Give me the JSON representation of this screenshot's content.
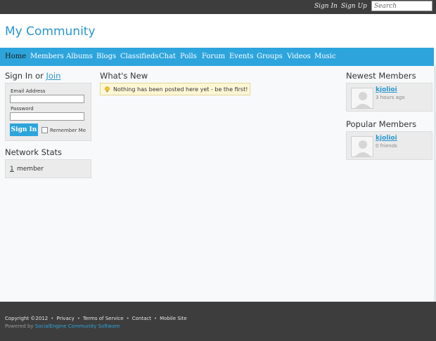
{
  "topbar": {
    "sign_in": "Sign In",
    "sign_up": "Sign Up",
    "search_placeholder": "Search"
  },
  "header": {
    "site_title": "My Community"
  },
  "nav": {
    "items": [
      "Home",
      "Members",
      "Albums",
      "Blogs",
      "Classifieds",
      "Chat",
      "Polls",
      "Forum",
      "Events",
      "Groups",
      "Videos",
      "Music"
    ],
    "active": "Home"
  },
  "signin": {
    "title_prefix": "Sign In or ",
    "title_join": "Join",
    "email_label": "Email Address",
    "password_label": "Password",
    "button_label": "Sign In",
    "remember_label": "Remember Me"
  },
  "stats": {
    "title": "Network Stats",
    "count": "1",
    "label": "member"
  },
  "whats_new": {
    "title": "What's New",
    "notice": "Nothing has been posted here yet - be the first!"
  },
  "newest": {
    "title": "Newest Members",
    "name": "kjolioi",
    "meta": "3 hours ago"
  },
  "popular": {
    "title": "Popular Members",
    "name": "kjolioi",
    "meta": "0 friends"
  },
  "footer": {
    "copyright": "Copyright ©2012",
    "links": [
      "Privacy",
      "Terms of Service",
      "Contact",
      "Mobile Site"
    ],
    "powered_prefix": "Powered by ",
    "powered_link": "SocialEngine Community Software"
  },
  "colors": {
    "accent": "#2da4dc",
    "link": "#2996cc",
    "bar": "#3d3d3d",
    "notice_bg": "#fff7d6"
  }
}
